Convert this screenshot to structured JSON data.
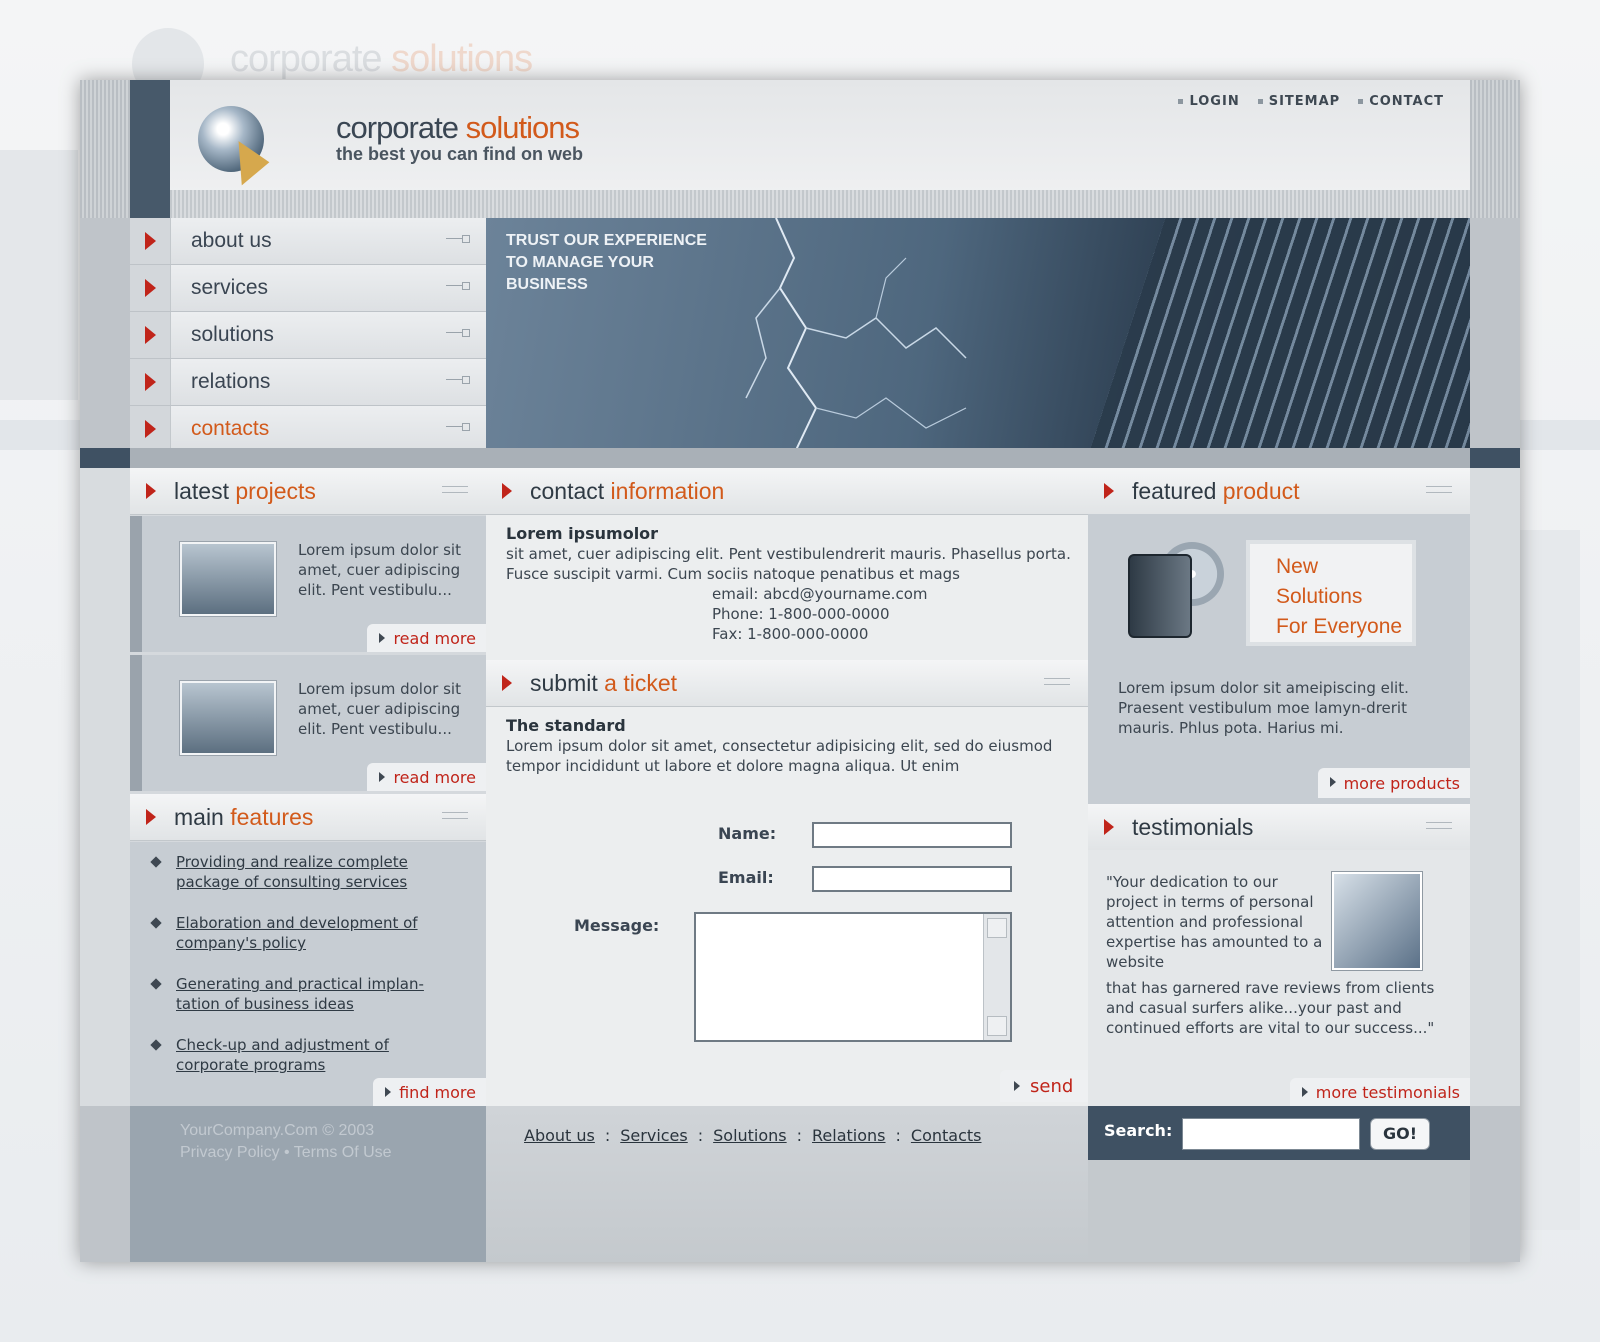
{
  "brand": {
    "title_main": "corporate",
    "title_accent": "solutions",
    "tagline": "the best you can find on web"
  },
  "top_links": [
    "LOGIN",
    "SITEMAP",
    "CONTACT"
  ],
  "nav": {
    "items": [
      {
        "label": "about us"
      },
      {
        "label": "services"
      },
      {
        "label": "solutions"
      },
      {
        "label": "relations"
      },
      {
        "label": "contacts"
      }
    ],
    "active": "contacts"
  },
  "hero": {
    "lines": [
      "TRUST OUR EXPERIENCE",
      "TO MANAGE YOUR",
      "BUSINESS"
    ]
  },
  "latest_projects": {
    "title_main": "latest",
    "title_accent": "projects",
    "items": [
      {
        "text": "Lorem ipsum dolor sit amet, cuer adipiscing elit. Pent vestibulu...",
        "link": "read more"
      },
      {
        "text": "Lorem ipsum dolor sit amet, cuer adipiscing elit. Pent vestibulu...",
        "link": "read more"
      }
    ]
  },
  "main_features": {
    "title_main": "main",
    "title_accent": "features",
    "items": [
      "Providing and realize complete package of consulting services",
      "Elaboration and development of company's policy",
      "Generating and practical implan-tation of business ideas",
      "Check-up and adjustment of corporate programs"
    ],
    "link": "find more"
  },
  "contact_info": {
    "title_main": "contact",
    "title_accent": "information",
    "heading": "Lorem ipsumolor",
    "body": "sit amet, cuer adipiscing elit. Pent vestibulendrerit mauris. Phasellus porta. Fusce suscipit varmi. Cum sociis natoque penatibus et mags",
    "email": "email: abcd@yourname.com",
    "phone": "Phone: 1-800-000-0000",
    "fax": "Fax: 1-800-000-0000"
  },
  "ticket": {
    "title_main": "submit",
    "title_accent": "a ticket",
    "heading": "The standard",
    "body": "Lorem ipsum dolor sit amet, consectetur adipisicing elit, sed do eiusmod tempor incididunt ut labore et dolore magna aliqua. Ut enim",
    "name_label": "Name:",
    "email_label": "Email:",
    "message_label": "Message:",
    "name_value": "",
    "email_value": "",
    "message_value": "",
    "send": "send"
  },
  "featured": {
    "title_main": "featured",
    "title_accent": "product",
    "card": [
      "New",
      "Solutions",
      "For Everyone"
    ],
    "text": "Lorem ipsum dolor sit ameipiscing elit. Praesent vestibulum moe lamyn-drerit mauris. Phlus pota. Harius mi.",
    "link": "more products"
  },
  "testimonials": {
    "title": "testimonials",
    "quote_part1": "\"Your dedication to our project in terms of personal attention and professional expertise has amounted to a website",
    "quote_part2": "that has garnered rave reviews from clients and casual surfers alike...your past and continued efforts are vital to our success...\"",
    "link": "more testimonials"
  },
  "footer": {
    "copyright": "YourCompany.Com © 2003",
    "legal": "Privacy Policy • Terms Of Use",
    "links": [
      "About us",
      "Services",
      "Solutions",
      "Relations",
      "Contacts"
    ],
    "separator": ":",
    "search_label": "Search:",
    "search_value": "",
    "go": "GO!"
  },
  "colors": {
    "accent": "#d25a1b",
    "arrow": "#c0241a",
    "dark": "#3f5163"
  }
}
